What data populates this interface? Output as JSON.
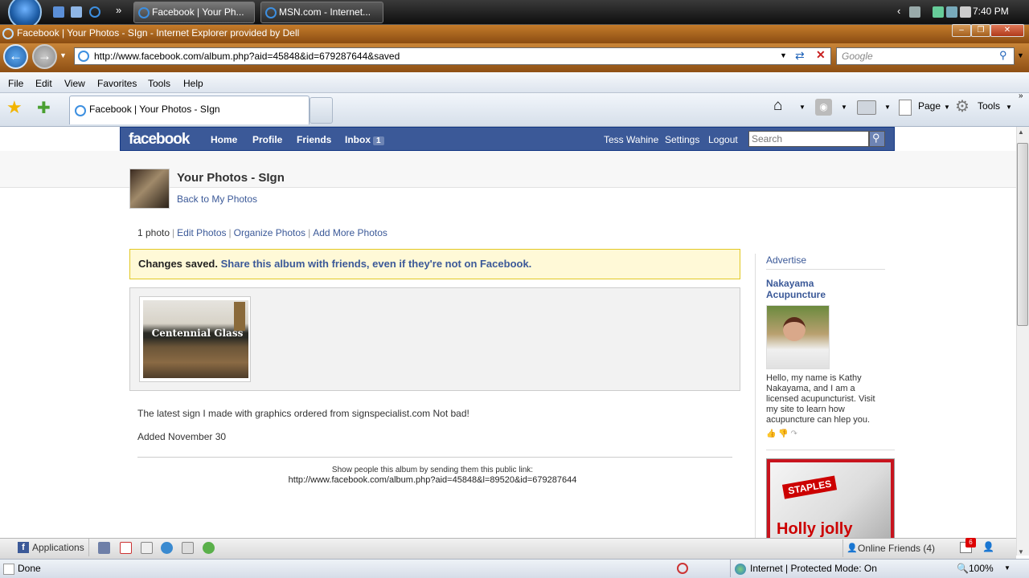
{
  "taskbar": {
    "tasks": [
      {
        "label": "Facebook | Your Ph..."
      },
      {
        "label": "MSN.com - Internet..."
      }
    ],
    "clock": "7:40 PM",
    "overflow": "»"
  },
  "window": {
    "title": "Facebook | Your Photos - SIgn - Internet Explorer provided by Dell"
  },
  "address_bar": {
    "url": "http://www.facebook.com/album.php?aid=45848&id=679287644&saved",
    "search_placeholder": "Google"
  },
  "menu": [
    "File",
    "Edit",
    "View",
    "Favorites",
    "Tools",
    "Help"
  ],
  "tab": {
    "label": "Facebook | Your Photos - SIgn"
  },
  "command_bar": {
    "page_label": "Page",
    "tools_label": "Tools"
  },
  "facebook": {
    "logo": "facebook",
    "nav": {
      "home": "Home",
      "profile": "Profile",
      "friends": "Friends",
      "inbox": "Inbox",
      "inbox_count": "1"
    },
    "user_nav": {
      "name": "Tess Wahine",
      "settings": "Settings",
      "logout": "Logout"
    },
    "search_placeholder": "Search",
    "page_title": "Your Photos - SIgn",
    "back_link": "Back to My Photos",
    "actions": {
      "count": "1 photo",
      "edit": "Edit Photos",
      "organize": "Organize Photos",
      "add_more": "Add More Photos"
    },
    "notice": {
      "saved": "Changes saved.",
      "share": "Share this album with friends, even if they're not on Facebook."
    },
    "photo_text": "Centennial Glass",
    "caption": "The latest sign I made with graphics ordered from signspecialist.com Not bad!",
    "added": "Added November 30",
    "share_prompt": "Show people this album by sending them this public link:",
    "public_link": "http://www.facebook.com/album.php?aid=45848&l=89520&id=679287644",
    "sidebar": {
      "advertise": "Advertise",
      "ad_title": "Nakayama Acupuncture",
      "ad_text": "Hello, my name is Kathy Nakayama, and I am a licensed acupuncturist. Visit my site to learn how acupuncture can hlep you.",
      "staples_brand": "STAPLES",
      "staples_headline": "Holly jolly"
    }
  },
  "chat_bar": {
    "applications": "Applications",
    "online_friends": "Online Friends",
    "online_count": "(4)",
    "notifications": "6"
  },
  "status_bar": {
    "status": "Done",
    "zone": "Internet | Protected Mode: On",
    "zoom": "100%"
  },
  "colors": {
    "facebook_blue": "#3b5998",
    "notice_bg": "#fff9d7",
    "ie_frame": "#b06a22"
  }
}
